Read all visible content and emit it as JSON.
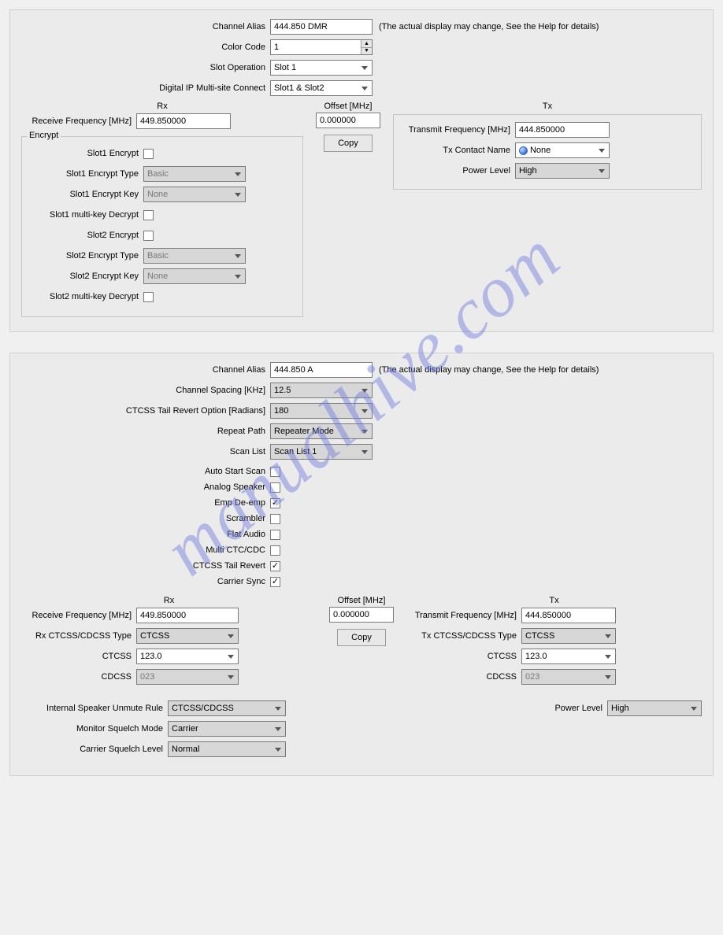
{
  "watermark": "manualhive.com",
  "help_text": "(The actual display may change, See the Help for details)",
  "panel1": {
    "channel_alias_label": "Channel Alias",
    "channel_alias": "444.850 DMR",
    "color_code_label": "Color Code",
    "color_code": "1",
    "slot_op_label": "Slot Operation",
    "slot_op": "Slot 1",
    "digital_ip_label": "Digital IP Multi-site Connect",
    "digital_ip": "Slot1 & Slot2",
    "rx_title": "Rx",
    "rx_freq_label": "Receive Frequency [MHz]",
    "rx_freq": "449.850000",
    "offset_title": "Offset [MHz]",
    "offset": "0.000000",
    "copy_btn": "Copy",
    "tx_title": "Tx",
    "tx_freq_label": "Transmit Frequency [MHz]",
    "tx_freq": "444.850000",
    "tx_contact_label": "Tx Contact Name",
    "tx_contact": "None",
    "power_level_label": "Power Level",
    "power_level": "High",
    "encrypt": {
      "legend": "Encrypt",
      "slot1_enc_label": "Slot1 Encrypt",
      "slot1_type_label": "Slot1 Encrypt Type",
      "slot1_type": "Basic",
      "slot1_key_label": "Slot1 Encrypt Key",
      "slot1_key": "None",
      "slot1_mk_label": "Slot1 multi-key Decrypt",
      "slot2_enc_label": "Slot2 Encrypt",
      "slot2_type_label": "Slot2 Encrypt Type",
      "slot2_type": "Basic",
      "slot2_key_label": "Slot2 Encrypt Key",
      "slot2_key": "None",
      "slot2_mk_label": "Slot2 multi-key Decrypt"
    }
  },
  "panel2": {
    "channel_alias_label": "Channel Alias",
    "channel_alias": "444.850 A",
    "spacing_label": "Channel Spacing [KHz]",
    "spacing": "12.5",
    "ctcss_tail_opt_label": "CTCSS Tail Revert Option [Radians]",
    "ctcss_tail_opt": "180",
    "repeat_path_label": "Repeat Path",
    "repeat_path": "Repeater Mode",
    "scan_list_label": "Scan List",
    "scan_list": "Scan List 1",
    "checks": {
      "auto_start": "Auto Start Scan",
      "analog_spk": "Analog Speaker",
      "emp": "Emp De-emp",
      "scrambler": "Scrambler",
      "flat": "Flat Audio",
      "multi": "Multi CTC/CDC",
      "tail_revert": "CTCSS Tail Revert",
      "carrier_sync": "Carrier Sync"
    },
    "rx_title": "Rx",
    "rx_freq_label": "Receive Frequency [MHz]",
    "rx_freq": "449.850000",
    "rx_type_label": "Rx CTCSS/CDCSS Type",
    "rx_type": "CTCSS",
    "rx_ctcss_label": "CTCSS",
    "rx_ctcss": "123.0",
    "rx_cdcss_label": "CDCSS",
    "rx_cdcss": "023",
    "offset_title": "Offset [MHz]",
    "offset": "0.000000",
    "copy_btn": "Copy",
    "tx_title": "Tx",
    "tx_freq_label": "Transmit Frequency [MHz]",
    "tx_freq": "444.850000",
    "tx_type_label": "Tx CTCSS/CDCSS Type",
    "tx_type": "CTCSS",
    "tx_ctcss_label": "CTCSS",
    "tx_ctcss": "123.0",
    "tx_cdcss_label": "CDCSS",
    "tx_cdcss": "023",
    "unmute_label": "Internal Speaker Unmute Rule",
    "unmute": "CTCSS/CDCSS",
    "monitor_label": "Monitor Squelch Mode",
    "monitor": "Carrier",
    "carrier_sq_label": "Carrier Squelch Level",
    "carrier_sq": "Normal",
    "power_level_label": "Power Level",
    "power_level": "High"
  }
}
